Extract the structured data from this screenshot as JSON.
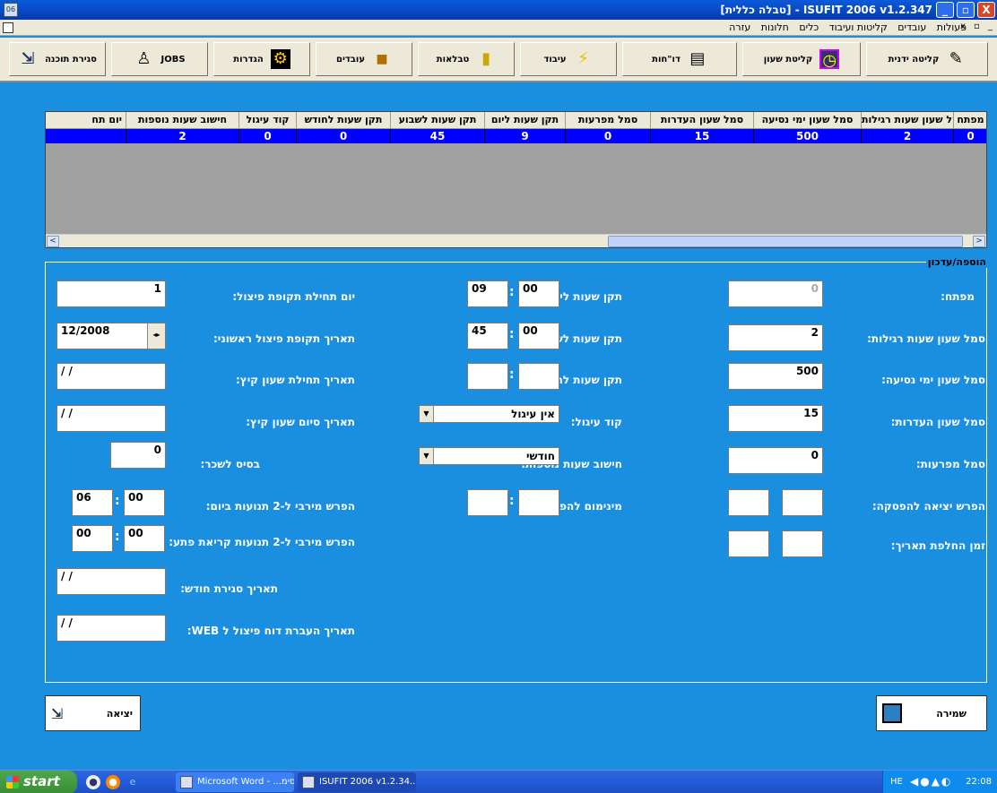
{
  "window": {
    "title": "[טבלה כללית] - ISUFIT 2006 v1.2.347",
    "minimize": "_",
    "maximize": "▫",
    "close": "X"
  },
  "menubar": {
    "items": [
      "פעולות",
      "עובדים",
      "קליטות ועיבוד",
      "כלים",
      "חלונות",
      "עזרה"
    ],
    "mdi_controls": "x ▫ _"
  },
  "toolbar": {
    "buttons": [
      {
        "label": "קליטה ידנית",
        "icon": "pencil-icon"
      },
      {
        "label": "קליטת שעון",
        "icon": "clock-icon"
      },
      {
        "label": "דו\"חות",
        "icon": "report-icon"
      },
      {
        "label": "עיבוד",
        "icon": "lightning-icon"
      },
      {
        "label": "טבלאות",
        "icon": "folder-icon"
      },
      {
        "label": "עובדים",
        "icon": "book-icon"
      },
      {
        "label": "הגדרות",
        "icon": "settings-icon"
      },
      {
        "label": "JOBS",
        "icon": "person-icon"
      },
      {
        "label": "סגירת תוכנה",
        "icon": "exit-icon"
      }
    ]
  },
  "grid": {
    "headers": [
      "מפתח",
      "סמל שעון שעות רגילות",
      "סמל שעון ימי נסיעה",
      "סמל שעון העדרות",
      "סמל מפרעות",
      "תקן שעות ליום",
      "תקן שעות לשבוע",
      "תקן שעות לחודש",
      "קוד עיגול",
      "חישוב שעות נוספות",
      "יום תח"
    ],
    "row": [
      "0",
      "2",
      "500",
      "15",
      "0",
      "9",
      "45",
      "0",
      "0",
      "2",
      ""
    ],
    "scroll_left": "<",
    "scroll_right": ">"
  },
  "form": {
    "group_label": "הוספה/עדכון",
    "right": {
      "key_label": "מפתח:",
      "key_value": "0",
      "regular_label": "סמל שעון שעות רגילות:",
      "regular_value": "2",
      "travel_label": "סמל שעון ימי נסיעה:",
      "travel_value": "500",
      "absence_label": "סמל שעון העדרות:",
      "absence_value": "15",
      "advances_label": "סמל מפרעות:",
      "advances_value": "0",
      "break_exit_label": "הפרש יציאה להפסקה:",
      "date_change_label": "זמן החלפת תאריך:"
    },
    "middle": {
      "daily_label": "תקן שעות ליום:",
      "daily_h": "09",
      "daily_m": "00",
      "weekly_label": "תקן שעות לשבוע:",
      "weekly_h": "45",
      "weekly_m": "00",
      "monthly_label": "תקן שעות לחודש:",
      "rounding_label": "קוד עיגול:",
      "rounding_value": "אין עיגול",
      "overtime_label": "חישוב שעות נוספות:",
      "overtime_value": "חודשי",
      "min_break_label": "מינימום להפסקה:"
    },
    "left": {
      "split_day_label": "יום תחילת תקופת פיצול:",
      "split_day_value": "1",
      "first_split_label": "תאריך תקופת פיצול ראשוני:",
      "first_split_value": "12/2008",
      "summer_start_label": "תאריך תחילת שעון קיץ:",
      "summer_start_value": "/ /",
      "summer_end_label": "תאריך סיום שעון קיץ:",
      "summer_end_value": "/ /",
      "salary_base_label": "בסיס לשכר:",
      "salary_base_value": "0",
      "max_gap_label": "הפרש מירבי ל-2 תנועות ביום:",
      "max_gap_h": "06",
      "max_gap_m": "00",
      "max_gap_open_label": "הפרש מירבי ל-2 תנועות קריאת פתע:",
      "max_gap_open_h": "00",
      "max_gap_open_m": "00",
      "month_close_label": "תאריך סגירת חודש:",
      "month_close_value": "/ /",
      "web_label": "תאריך העברת דוח פיצול ל WEB:",
      "web_value": "/ /"
    }
  },
  "buttons": {
    "save": "שמירה",
    "exit": "יציאה"
  },
  "taskbar": {
    "start": "start",
    "tasks": [
      "Microsoft Word - ...סימ",
      "ISUFIT 2006 v1.2.34..."
    ],
    "lang": "HE",
    "clock": "22:08"
  }
}
